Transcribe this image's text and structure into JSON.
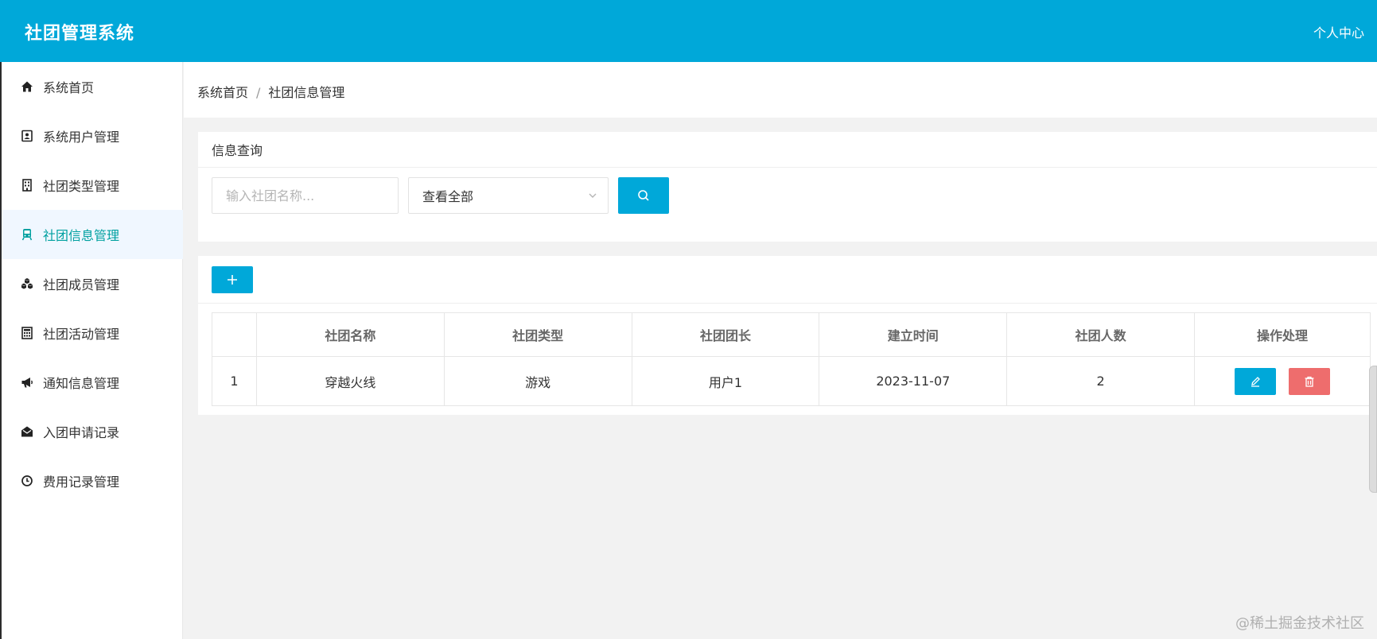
{
  "header": {
    "brand": "社团管理系统",
    "user_center": "个人中心"
  },
  "sidebar": {
    "items": [
      {
        "label": "系统首页",
        "icon": "home-icon"
      },
      {
        "label": "系统用户管理",
        "icon": "user-card-icon"
      },
      {
        "label": "社团类型管理",
        "icon": "building-icon"
      },
      {
        "label": "社团信息管理",
        "icon": "train-icon",
        "active": true
      },
      {
        "label": "社团成员管理",
        "icon": "cubes-icon"
      },
      {
        "label": "社团活动管理",
        "icon": "calculator-icon"
      },
      {
        "label": "通知信息管理",
        "icon": "megaphone-icon"
      },
      {
        "label": "入团申请记录",
        "icon": "envelope-open-icon"
      },
      {
        "label": "费用记录管理",
        "icon": "clock-icon"
      }
    ]
  },
  "breadcrumb": {
    "home": "系统首页",
    "separator": "/",
    "current": "社团信息管理"
  },
  "query": {
    "title": "信息查询",
    "name_placeholder": "输入社团名称...",
    "type_selected": "查看全部"
  },
  "table": {
    "headers": [
      "",
      "社团名称",
      "社团类型",
      "社团团长",
      "建立时间",
      "社团人数",
      "操作处理"
    ],
    "rows": [
      {
        "index": "1",
        "name": "穿越火线",
        "type": "游戏",
        "leader": "用户1",
        "created": "2023-11-07",
        "members": "2"
      }
    ]
  },
  "colors": {
    "primary": "#00a8d9",
    "danger": "#ee6d6d",
    "active_text": "#00a0a0"
  },
  "watermark": "@稀土掘金技术社区"
}
